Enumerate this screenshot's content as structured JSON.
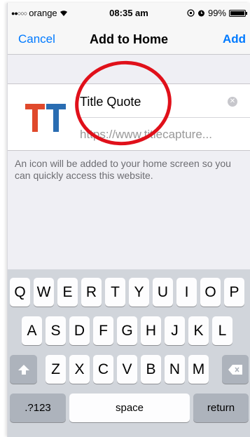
{
  "status_bar": {
    "carrier": "orange",
    "time": "08:35 am",
    "battery": "99%",
    "battery_level": 0.99
  },
  "nav": {
    "cancel": "Cancel",
    "title": "Add to Home",
    "add": "Add"
  },
  "bookmark": {
    "icon_text": "TT",
    "icon_colors": [
      "#e0492c",
      "#2a6db2"
    ],
    "title": "Title Quote",
    "url": "https://www.titlecapture..."
  },
  "hint": "An icon will be added to your home screen so you can quickly access this website.",
  "annotation_color": "#e0101a",
  "keyboard": {
    "row1": [
      "Q",
      "W",
      "E",
      "R",
      "T",
      "Y",
      "U",
      "I",
      "O",
      "P"
    ],
    "row2": [
      "A",
      "S",
      "D",
      "F",
      "G",
      "H",
      "J",
      "K",
      "L"
    ],
    "row3": [
      "Z",
      "X",
      "C",
      "V",
      "B",
      "N",
      "M"
    ],
    "numbers": ".?123",
    "space": "space",
    "return": "return",
    "shift_icon": "shift-icon",
    "delete_icon": "delete-icon"
  }
}
